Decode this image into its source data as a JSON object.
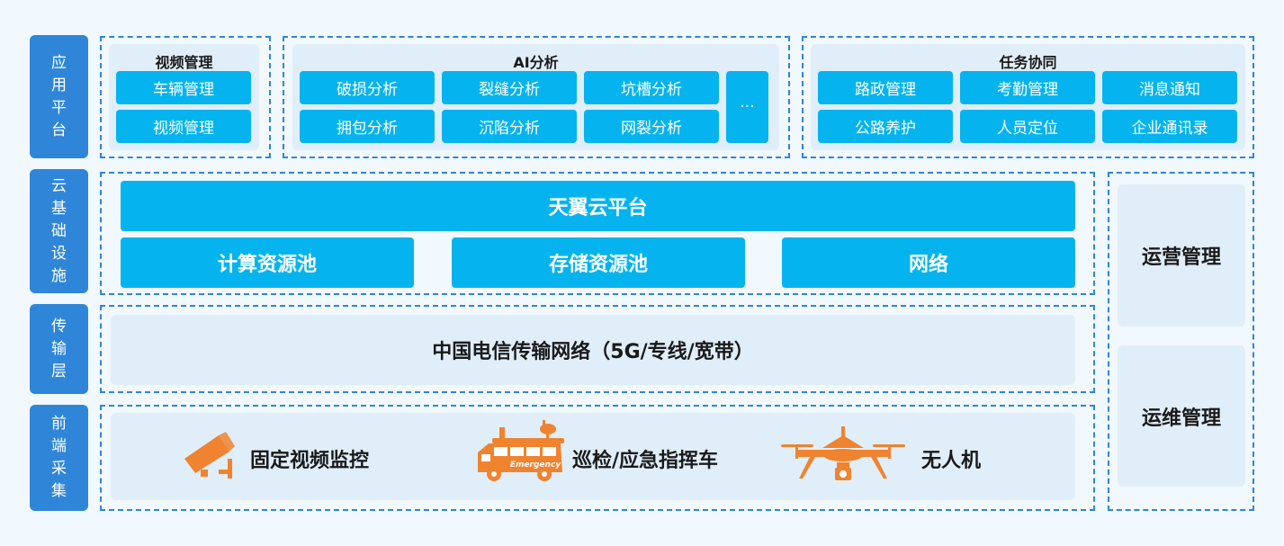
{
  "layers": {
    "app": "应用平台",
    "cloud": "云基础设施",
    "transport": "传输层",
    "frontend": "前端采集"
  },
  "app": {
    "video": {
      "title": "视频管理",
      "items": [
        "车辆管理",
        "视频管理"
      ]
    },
    "ai": {
      "title": "AI分析",
      "items": [
        "破损分析",
        "裂缝分析",
        "坑槽分析",
        "拥包分析",
        "沉陷分析",
        "网裂分析"
      ],
      "more": "···"
    },
    "task": {
      "title": "任务协同",
      "items": [
        "路政管理",
        "考勤管理",
        "消息通知",
        "公路养护",
        "人员定位",
        "企业通讯录"
      ]
    }
  },
  "cloud": {
    "platform": "天翼云平台",
    "items": [
      "计算资源池",
      "存储资源池",
      "网络"
    ]
  },
  "transport": {
    "network": "中国电信传输网络（5G/专线/宽带）"
  },
  "frontend": {
    "items": [
      "固定视频监控",
      "巡检/应急指挥车",
      "无人机"
    ],
    "truck_text": "Emergency",
    "icons": [
      "security-camera-icon",
      "emergency-truck-icon",
      "drone-icon"
    ]
  },
  "right": {
    "ops": "运营管理",
    "maint": "运维管理"
  },
  "colors": {
    "layer": "#2f86d9",
    "button": "#05b4ee",
    "icon": "#f0832f",
    "panel": "#e0eefa"
  }
}
